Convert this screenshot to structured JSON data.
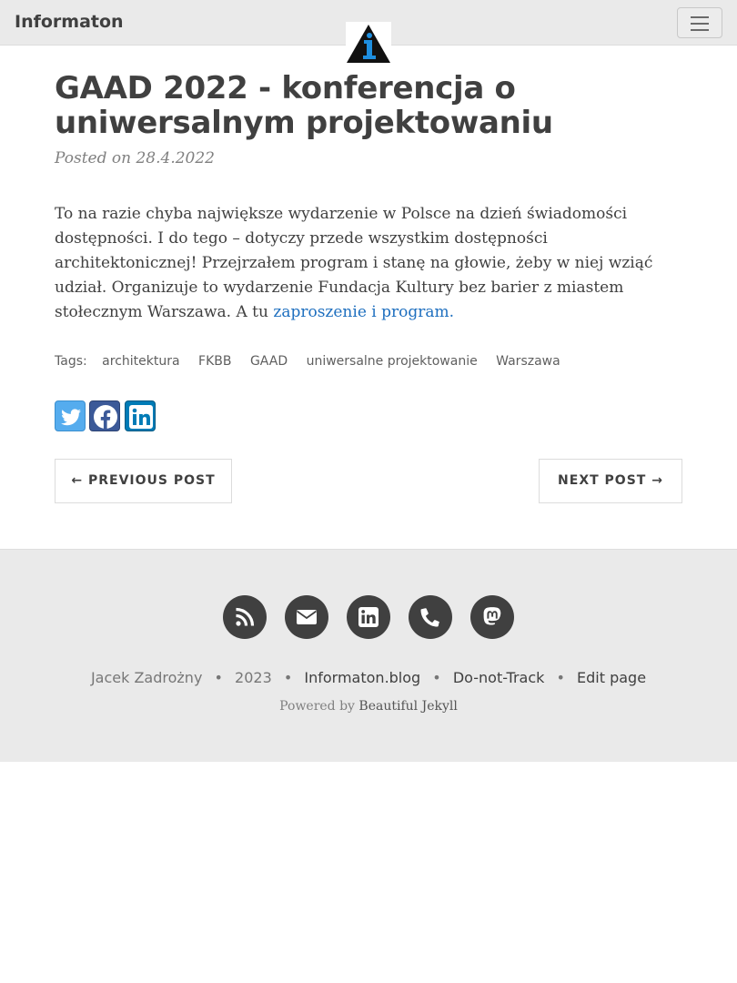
{
  "nav": {
    "brand": "Informaton",
    "menu_icon": "hamburger-icon",
    "logo_icon": "info-triangle-logo"
  },
  "post": {
    "title": "GAAD 2022 - konferencja o uniwersalnym projektowaniu",
    "meta": "Posted on 28.4.2022",
    "body_text": "To na razie chyba największe wydarzenie w Polsce na dzień świadomości dostępności. I do tego – dotyczy przede wszystkim dostępności architektonicznej! Przejrzałem program i stanę na głowie, żeby w niej wziąć udział. Organizuje to wydarzenie Fundacja Kultury bez barier z miastem stołecznym Warszawa. A tu ",
    "body_link": "zaproszenie i program."
  },
  "tags": {
    "label": "Tags:",
    "items": [
      "architektura",
      "FKBB",
      "GAAD",
      "uniwersalne projektowanie",
      "Warszawa"
    ]
  },
  "share": {
    "icons": [
      "twitter-icon",
      "facebook-icon",
      "linkedin-icon"
    ]
  },
  "pager": {
    "previous": "← PREVIOUS POST",
    "next": "NEXT POST →"
  },
  "footer": {
    "social_icons": [
      "rss-icon",
      "email-icon",
      "linkedin-icon",
      "phone-icon",
      "mastodon-icon"
    ],
    "author": "Jacek Zadrożny",
    "year": "2023",
    "site": "Informaton.blog",
    "dnt": "Do-not-Track",
    "edit": "Edit page",
    "powered_prefix": "Powered by",
    "powered_theme": "Beautiful Jekyll",
    "separator": "•"
  },
  "colors": {
    "navbar_bg": "#eaeaea",
    "footer_bg": "#eaeaea",
    "text": "#404040",
    "link": "#1e6fbf",
    "twitter": "#55acee",
    "facebook": "#3b5998",
    "linkedin": "#007bb6",
    "logo_blue": "#1e8fe0"
  }
}
